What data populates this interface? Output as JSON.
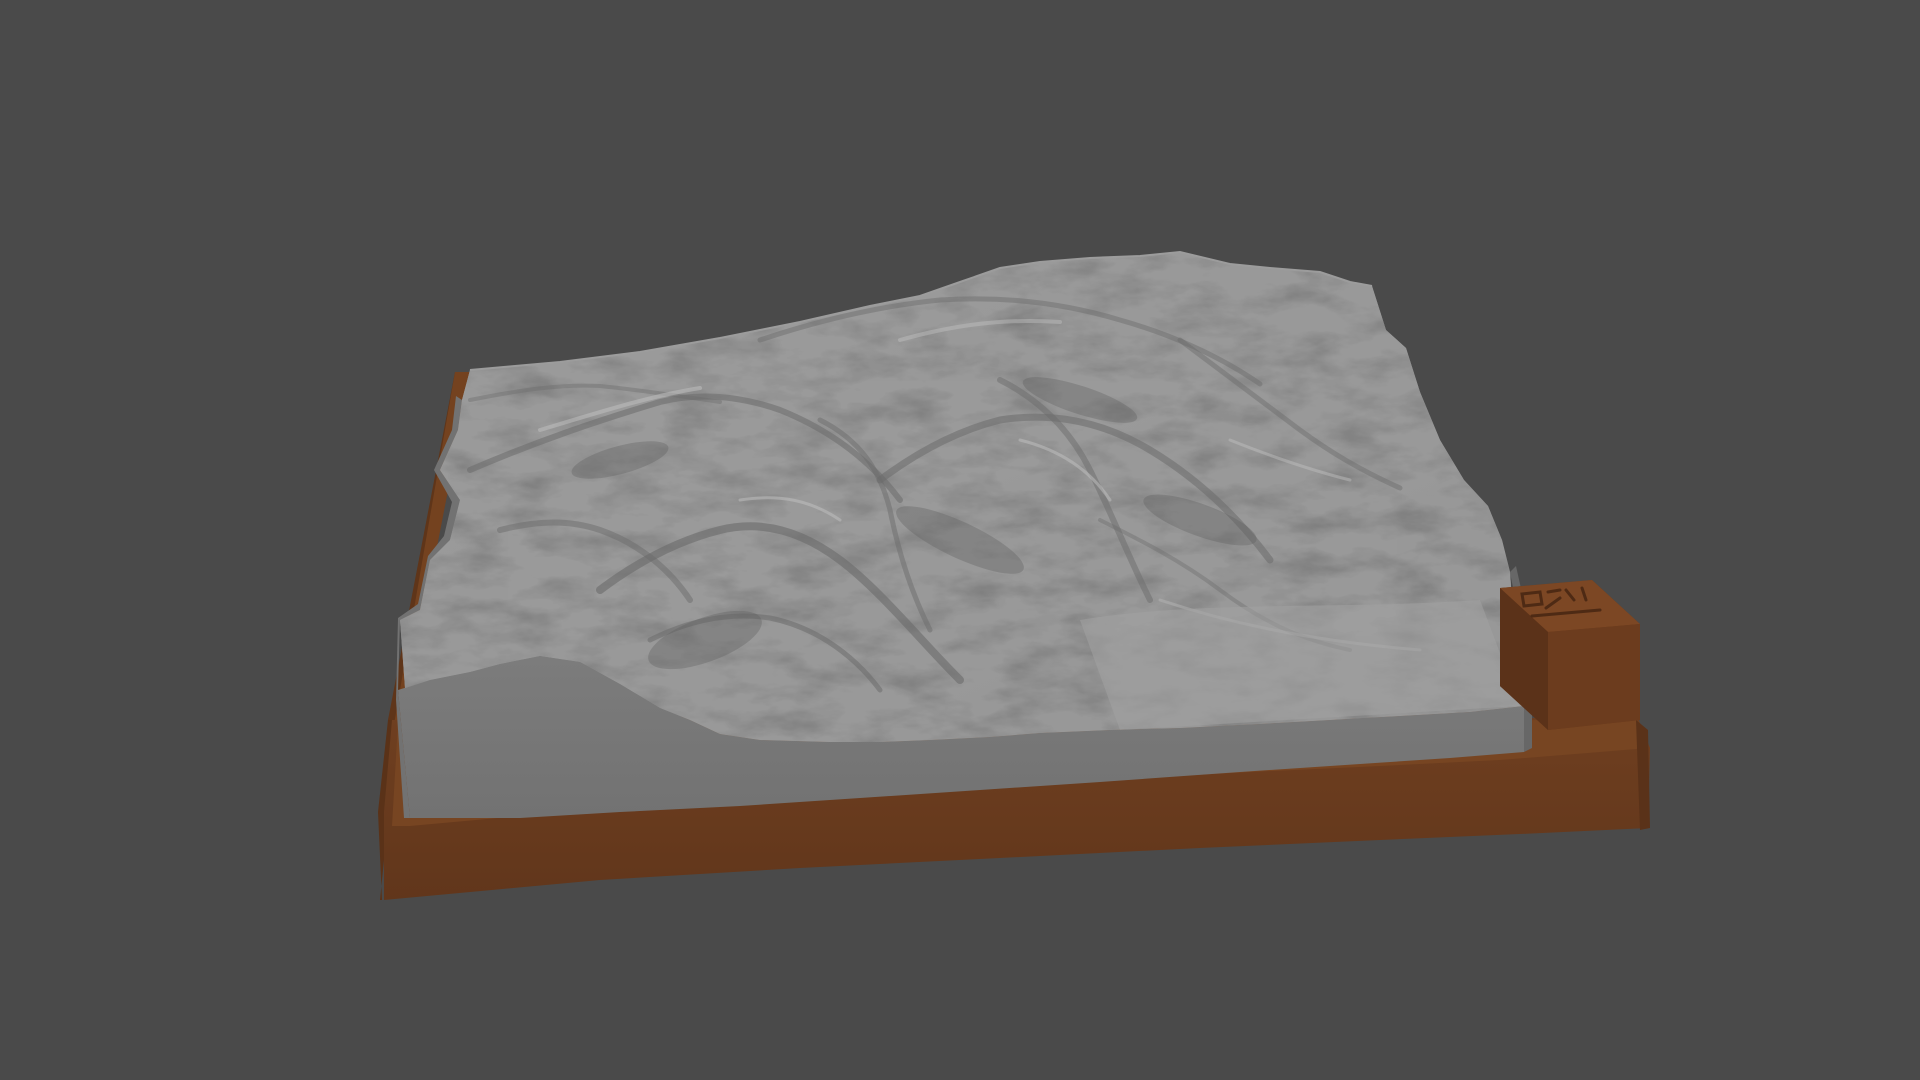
{
  "viewport": {
    "background": "#4a4a4a"
  },
  "model": {
    "base_color": "#6b3d1f",
    "base_top_color": "#7a4523",
    "base_shadow_color": "#5a3219",
    "terrain_light": "#a9a9a9",
    "terrain_mid": "#8e8e8e",
    "terrain_dark": "#6a6a6a",
    "terrain_side": "#7a7a7a",
    "terrain_side_dark": "#6e6e6e",
    "compass_block_icon": "compass-block-icon"
  }
}
